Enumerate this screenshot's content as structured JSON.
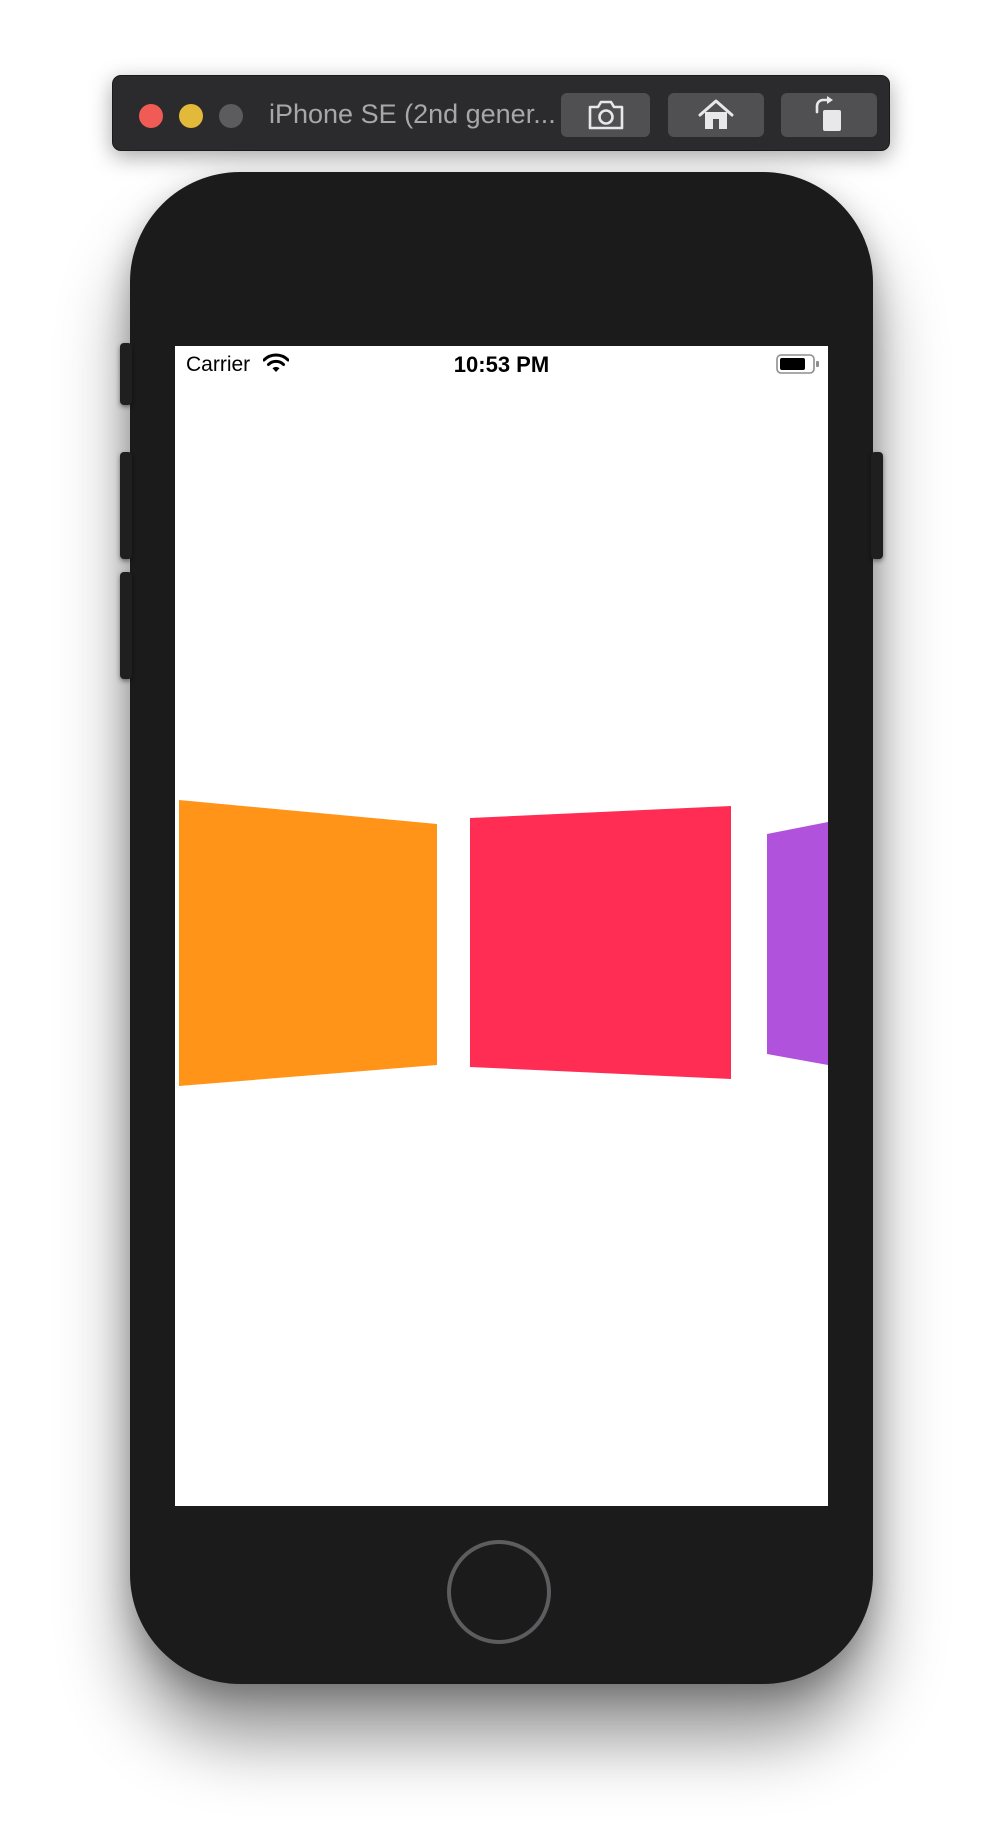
{
  "window": {
    "title": "iPhone SE (2nd gener...",
    "traffic_lights": {
      "close_color": "#f15b55",
      "minimize_color": "#e3b93a",
      "zoom_color": "#5c5c5e"
    },
    "toolbar_buttons": [
      "camera-icon",
      "home-icon",
      "rotate-icon"
    ]
  },
  "status_bar": {
    "carrier": "Carrier",
    "time": "10:53 PM",
    "wifi_icon": "wifi-icon",
    "battery_icon": "battery-icon"
  },
  "cards": [
    {
      "name": "orange-card",
      "color": "#ff9419"
    },
    {
      "name": "red-card",
      "color": "#ff2c54"
    },
    {
      "name": "purple-card",
      "color": "#b052dc"
    }
  ],
  "colors": {
    "titlebar": "#2b2b2d",
    "device_body": "#1b1b1c",
    "screen": "#ffffff"
  }
}
